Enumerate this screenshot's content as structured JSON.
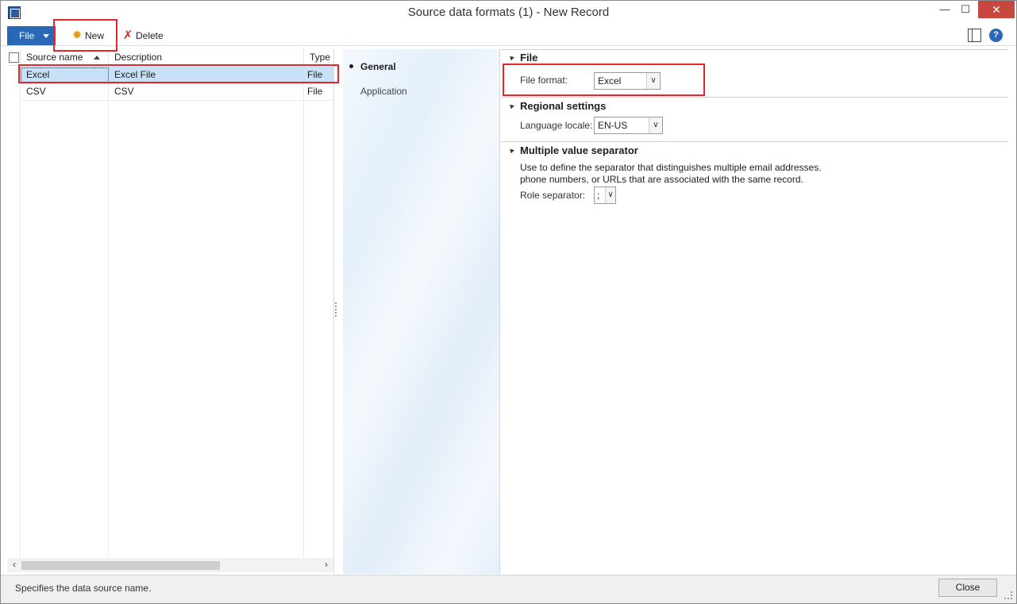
{
  "window": {
    "title": "Source data formats (1) - New Record",
    "controls": {
      "minimize": "—",
      "maximize": "☐",
      "close": "✕"
    }
  },
  "toolbar": {
    "file_label": "File",
    "new_label": "New",
    "delete_label": "Delete",
    "icons": [
      "layout-icon",
      "help-icon"
    ],
    "help_glyph": "?"
  },
  "grid": {
    "columns": [
      "Source name",
      "Description",
      "Type"
    ],
    "rows": [
      {
        "source": "Excel",
        "description": "Excel File",
        "type": "File",
        "selected": true
      },
      {
        "source": "CSV",
        "description": "CSV",
        "type": "File",
        "selected": false
      }
    ]
  },
  "nav": {
    "items": [
      "General",
      "Application"
    ],
    "active": "General"
  },
  "details": {
    "file": {
      "title": "File",
      "format_label": "File format:",
      "format_value": "Excel"
    },
    "regional": {
      "title": "Regional settings",
      "locale_label": "Language locale:",
      "locale_value": "EN-US"
    },
    "separator": {
      "title": "Multiple value separator",
      "description_line1": "Use to define the separator that distinguishes multiple email addresses.",
      "description_line2": "phone numbers, or URLs that are associated with the same record.",
      "role_label": "Role separator:",
      "role_value": ";"
    }
  },
  "status": {
    "text": "Specifies the data source name.",
    "close_label": "Close"
  },
  "colors": {
    "accent": "#2b67b7",
    "selected_row": "#c9e1f7",
    "annotation": "#e8242b",
    "close_button": "#c7463d"
  }
}
